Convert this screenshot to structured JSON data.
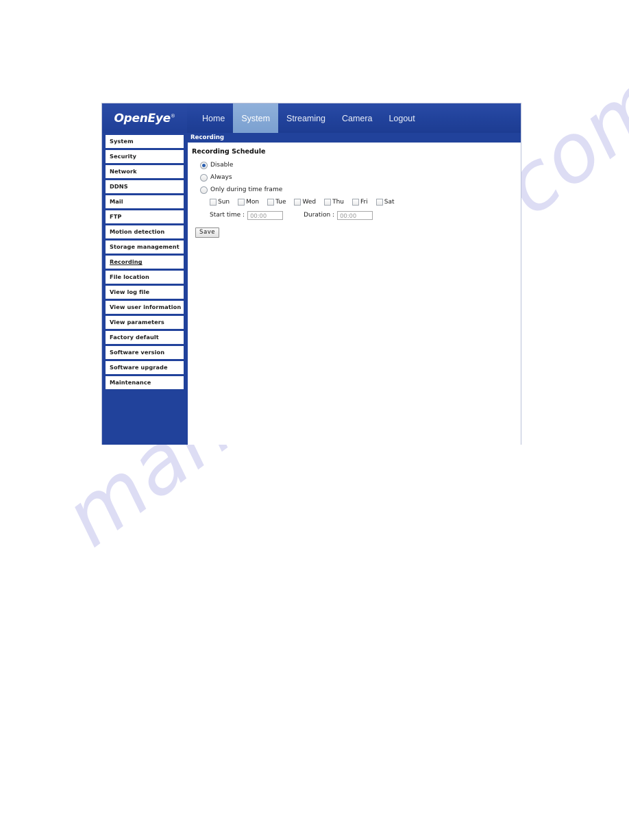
{
  "brand": {
    "logo_text": "OpenEye",
    "logo_trademark": "®"
  },
  "top_nav": {
    "tabs": [
      {
        "label": "Home",
        "active": false
      },
      {
        "label": "System",
        "active": true
      },
      {
        "label": "Streaming",
        "active": false
      },
      {
        "label": "Camera",
        "active": false
      },
      {
        "label": "Logout",
        "active": false
      }
    ]
  },
  "sidebar": {
    "items": [
      {
        "label": "System",
        "active": false
      },
      {
        "label": "Security",
        "active": false
      },
      {
        "label": "Network",
        "active": false
      },
      {
        "label": "DDNS",
        "active": false
      },
      {
        "label": "Mail",
        "active": false
      },
      {
        "label": "FTP",
        "active": false
      },
      {
        "label": "Motion detection",
        "active": false
      },
      {
        "label": "Storage management",
        "active": false
      },
      {
        "label": "Recording",
        "active": true
      },
      {
        "label": "File location",
        "active": false
      },
      {
        "label": "View log file",
        "active": false
      },
      {
        "label": "View user information",
        "active": false
      },
      {
        "label": "View parameters",
        "active": false
      },
      {
        "label": "Factory default",
        "active": false
      },
      {
        "label": "Software version",
        "active": false
      },
      {
        "label": "Software upgrade",
        "active": false
      },
      {
        "label": "Maintenance",
        "active": false
      }
    ]
  },
  "content": {
    "title_bar": "Recording",
    "section_heading": "Recording Schedule",
    "schedule_modes": [
      {
        "label": "Disable",
        "selected": true
      },
      {
        "label": "Always",
        "selected": false
      },
      {
        "label": "Only during time frame",
        "selected": false
      }
    ],
    "days": [
      {
        "label": "Sun",
        "checked": false
      },
      {
        "label": "Mon",
        "checked": false
      },
      {
        "label": "Tue",
        "checked": false
      },
      {
        "label": "Wed",
        "checked": false
      },
      {
        "label": "Thu",
        "checked": false
      },
      {
        "label": "Fri",
        "checked": false
      },
      {
        "label": "Sat",
        "checked": false
      }
    ],
    "start_time": {
      "label": "Start time :",
      "value": "00:00",
      "placeholder": "00:00"
    },
    "duration": {
      "label": "Duration :",
      "value": "00:00",
      "placeholder": "00:00"
    },
    "save_label": "Save"
  },
  "watermark": {
    "text": "manualshive.com",
    "color": "#c9c9ee"
  },
  "colors": {
    "brand_blue": "#21429b",
    "active_tab_blue": "#7fa3d2",
    "panel_white": "#ffffff",
    "radio_dot": "#2a5fb0"
  }
}
